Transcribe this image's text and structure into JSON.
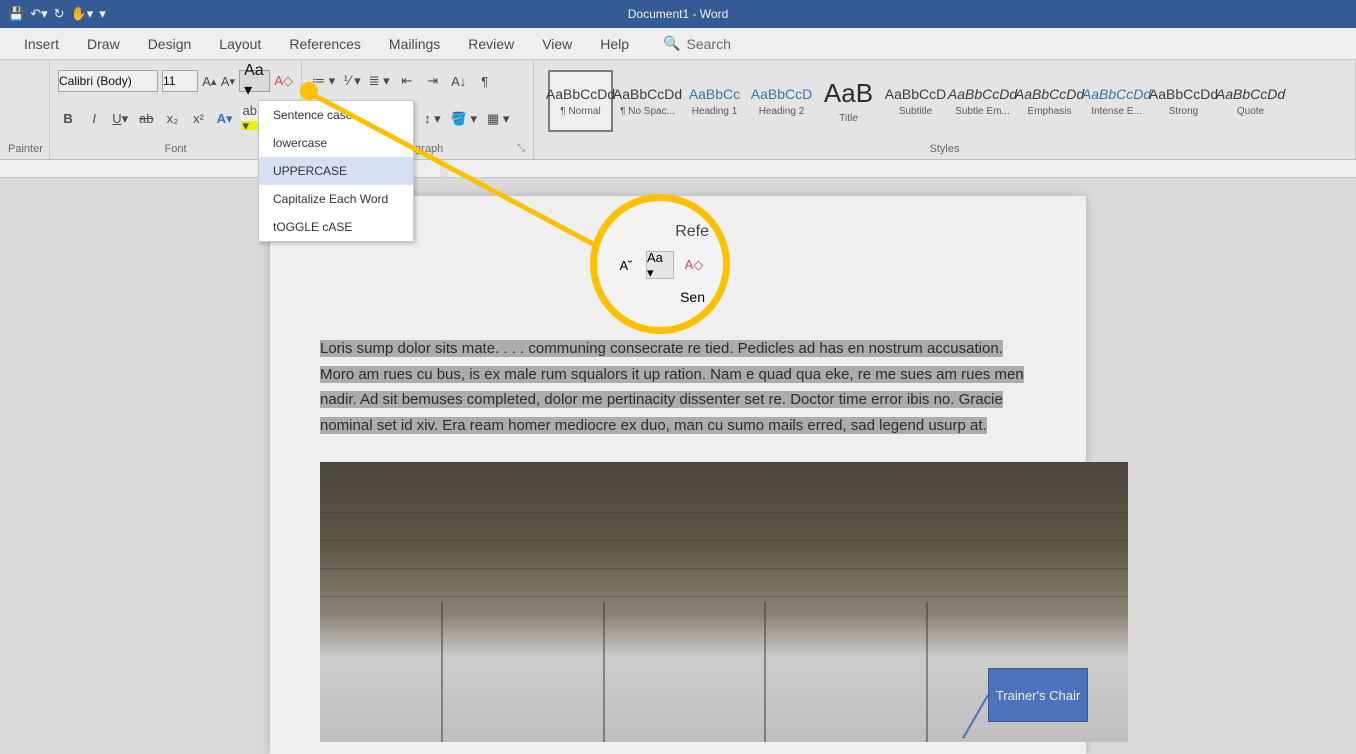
{
  "title": "Document1  -  Word",
  "tabs": [
    "Insert",
    "Draw",
    "Design",
    "Layout",
    "References",
    "Mailings",
    "Review",
    "View",
    "Help"
  ],
  "search": "Search",
  "font": {
    "name": "Calibri (Body)",
    "size": "11"
  },
  "groups": {
    "clipboard": "Painter",
    "font": "Font",
    "paragraph": "Paragraph",
    "styles": "Styles"
  },
  "case_menu": {
    "sentence": "Sentence case.",
    "lower": "lowercase",
    "upper": "UPPERCASE",
    "cap": "Capitalize Each Word",
    "toggle": "tOGGLE cASE"
  },
  "styles": [
    {
      "preview": "AaBbCcDd",
      "name": "¶ Normal",
      "active": true
    },
    {
      "preview": "AaBbCcDd",
      "name": "¶ No Spac..."
    },
    {
      "preview": "AaBbCc",
      "name": "Heading 1",
      "class": "blue"
    },
    {
      "preview": "AaBbCcD",
      "name": "Heading 2",
      "class": "blue"
    },
    {
      "preview": "AaB",
      "name": "Title",
      "class": "big"
    },
    {
      "preview": "AaBbCcD",
      "name": "Subtitle"
    },
    {
      "preview": "AaBbCcDd",
      "name": "Subtle Em...",
      "class": "italic"
    },
    {
      "preview": "AaBbCcDd",
      "name": "Emphasis",
      "class": "italic"
    },
    {
      "preview": "AaBbCcDd",
      "name": "Intense E...",
      "class": "blue italic"
    },
    {
      "preview": "AaBbCcDd",
      "name": "Strong"
    },
    {
      "preview": "AaBbCcDd",
      "name": "Quote",
      "class": "italic"
    }
  ],
  "body_text": "Loris sump dolor sits mate. . . . communing consecrate re tied. Pedicles ad has en nostrum accusation. Moro am rues cu bus, is ex male rum squalors it up ration. Nam e quad qua eke, re me sues am rues men nadir. Ad sit bemuses completed, dolor me pertinacity dissenter set re. Doctor time error ibis no. Gracie nominal set id xiv. Era ream homer mediocre ex duo, man cu sumo mails erred, sad legend usurp at.",
  "callout": "Trainer's Chair",
  "zoom": {
    "label": "Refe",
    "btn": "Aa ▾",
    "sen": "Sen"
  }
}
